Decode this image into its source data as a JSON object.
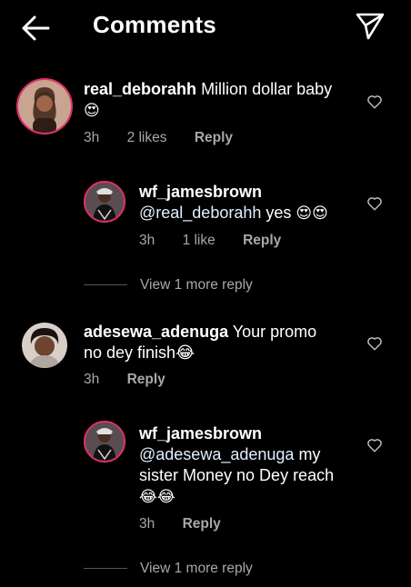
{
  "header": {
    "title": "Comments"
  },
  "comments": [
    {
      "username": "real_deborahh",
      "text": "Million dollar baby",
      "text_line2": "😍",
      "time": "3h",
      "likes": "2 likes",
      "reply": "Reply"
    },
    {
      "username": "wf_jamesbrown",
      "mention": "@real_deborahh",
      "text": "yes",
      "emoji": "😍😍",
      "time": "3h",
      "likes": "1 like",
      "reply": "Reply"
    },
    {
      "view_more": "View 1 more reply"
    },
    {
      "username": "adesewa_adenuga",
      "text": "Your promo",
      "text_line2": "no dey finish😂",
      "time": "3h",
      "reply": "Reply"
    },
    {
      "username": "wf_jamesbrown",
      "mention": "@adesewa_adenuga",
      "text": "my",
      "text_line2": "sister Money no Dey reach",
      "text_line3": "😂😂",
      "time": "3h",
      "reply": "Reply"
    },
    {
      "view_more": "View 1 more reply"
    }
  ]
}
